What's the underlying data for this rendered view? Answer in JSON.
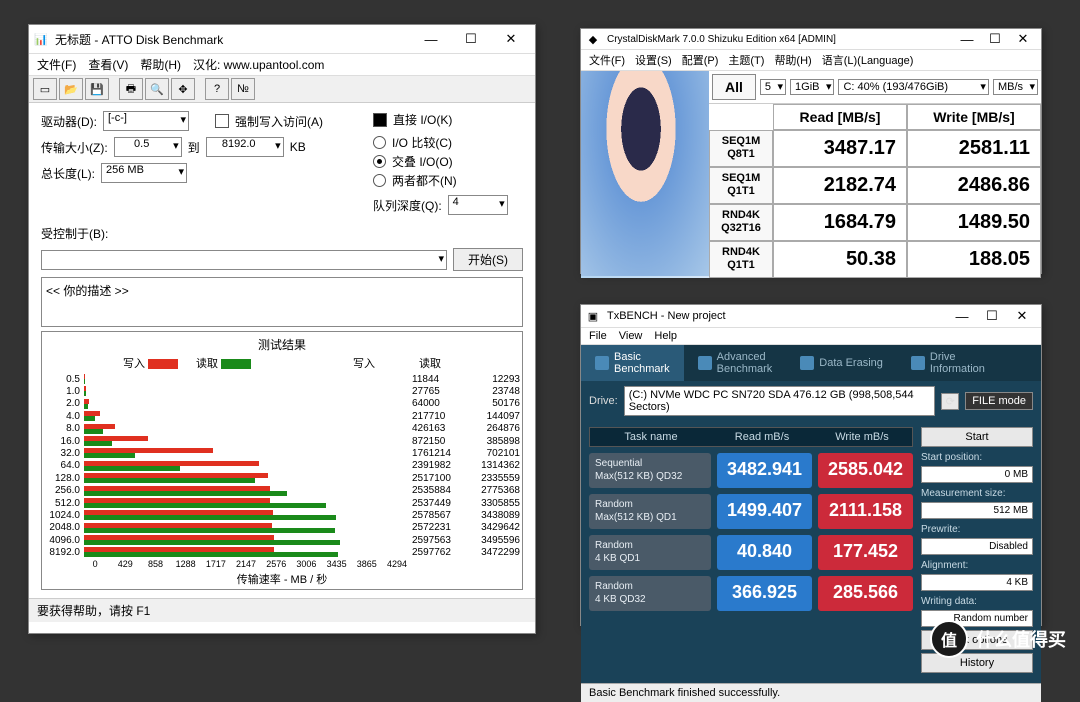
{
  "atto": {
    "title": "无标题 - ATTO Disk Benchmark",
    "menu": {
      "file": "文件(F)",
      "view": "查看(V)",
      "help": "帮助(H)",
      "trans": "汉化: www.upantool.com"
    },
    "labels": {
      "drive": "驱动器(D):",
      "drive_val": "[-c-]",
      "force": "强制写入访问(A)",
      "direct": "直接 I/O(K)",
      "xfer": "传输大小(Z):",
      "xfer_from": "0.5",
      "to": "到",
      "xfer_to": "8192.0",
      "kb": "KB",
      "iocmp": "I/O 比较(C)",
      "overlap": "交叠 I/O(O)",
      "neither": "两者都不(N)",
      "len": "总长度(L):",
      "len_val": "256 MB",
      "qd": "队列深度(Q):",
      "qd_val": "4",
      "ctrl": "受控制于(B):",
      "start": "开始(S)",
      "desc": "<<  你的描述  >>",
      "results": "测试结果",
      "write": "写入",
      "read": "读取",
      "xlabel": "传输速率 - MB / 秒",
      "whdr": "写入",
      "rhdr": "读取"
    },
    "status": "要获得帮助，请按 F1",
    "xticks": [
      "0",
      "429",
      "858",
      "1288",
      "1717",
      "2147",
      "2576",
      "3006",
      "3435",
      "3865",
      "4294"
    ]
  },
  "cdm": {
    "title": "CrystalDiskMark 7.0.0 Shizuku Edition x64 [ADMIN]",
    "menu": {
      "file": "文件(F)",
      "settings": "设置(S)",
      "profile": "配置(P)",
      "theme": "主题(T)",
      "help": "帮助(H)",
      "lang": "语言(L)(Language)"
    },
    "top": {
      "count": "5",
      "size": "1GiB",
      "drive": "C: 40% (193/476GiB)",
      "unit": "MB/s",
      "all": "All"
    },
    "hdr": {
      "read": "Read [MB/s]",
      "write": "Write [MB/s]"
    },
    "rows": [
      {
        "l1": "SEQ1M",
        "l2": "Q8T1",
        "r": "3487.17",
        "w": "2581.11"
      },
      {
        "l1": "SEQ1M",
        "l2": "Q1T1",
        "r": "2182.74",
        "w": "2486.86"
      },
      {
        "l1": "RND4K",
        "l2": "Q32T16",
        "r": "1684.79",
        "w": "1489.50"
      },
      {
        "l1": "RND4K",
        "l2": "Q1T1",
        "r": "50.38",
        "w": "188.05"
      }
    ]
  },
  "tx": {
    "title": "TxBENCH - New project",
    "menu": {
      "file": "File",
      "view": "View",
      "help": "Help"
    },
    "tabs": {
      "basic": "Basic\nBenchmark",
      "adv": "Advanced\nBenchmark",
      "erase": "Data Erasing",
      "info": "Drive\nInformation"
    },
    "drive_lbl": "Drive:",
    "drive": "(C:) NVMe WDC PC SN720 SDA  476.12 GB (998,508,544 Sectors)",
    "filemode": "FILE mode",
    "hdrs": {
      "task": "Task name",
      "read": "Read mB/s",
      "write": "Write mB/s"
    },
    "rows": [
      {
        "n1": "Sequential",
        "n2": "Max(512 KB) QD32",
        "r": "3482.941",
        "w": "2585.042"
      },
      {
        "n1": "Random",
        "n2": "Max(512 KB) QD1",
        "r": "1499.407",
        "w": "2111.158"
      },
      {
        "n1": "Random",
        "n2": "4 KB QD1",
        "r": "40.840",
        "w": "177.452"
      },
      {
        "n1": "Random",
        "n2": "4 KB QD32",
        "r": "366.925",
        "w": "285.566"
      }
    ],
    "side": {
      "start": "Start",
      "startpos": "Start position:",
      "startpos_v": "0 MB",
      "msize": "Measurement size:",
      "msize_v": "512 MB",
      "prewrite": "Prewrite:",
      "prewrite_v": "Disabled",
      "align": "Alignment:",
      "align_v": "4 KB",
      "wdata": "Writing data:",
      "wdata_v": "Random number",
      "taskopt": "Task options",
      "history": "History"
    },
    "status": "Basic Benchmark finished successfully."
  },
  "wm": {
    "badge": "值",
    "text": "什么值得买"
  },
  "chart_data": {
    "type": "bar",
    "orientation": "horizontal",
    "title": "测试结果",
    "xlabel": "传输速率 - MB / 秒",
    "xlim": [
      0,
      4294
    ],
    "categories": [
      "0.5",
      "1.0",
      "2.0",
      "4.0",
      "8.0",
      "16.0",
      "32.0",
      "64.0",
      "128.0",
      "256.0",
      "512.0",
      "1024.0",
      "2048.0",
      "4096.0",
      "8192.0"
    ],
    "series": [
      {
        "name": "写入",
        "color": "#e03020",
        "values": [
          11844,
          27765,
          64000,
          217710,
          426163,
          872150,
          1761214,
          2391982,
          2517100,
          2535884,
          2537449,
          2578567,
          2572231,
          2597563,
          2597762
        ]
      },
      {
        "name": "读取",
        "color": "#1a8a1a",
        "values": [
          12293,
          23748,
          50176,
          144097,
          264876,
          385898,
          702101,
          1314362,
          2335559,
          2775368,
          3305855,
          3438089,
          3429642,
          3495596,
          3472299
        ]
      }
    ],
    "value_scale_note": "values shown in KB/s in table; bar lengths use MB/s"
  }
}
